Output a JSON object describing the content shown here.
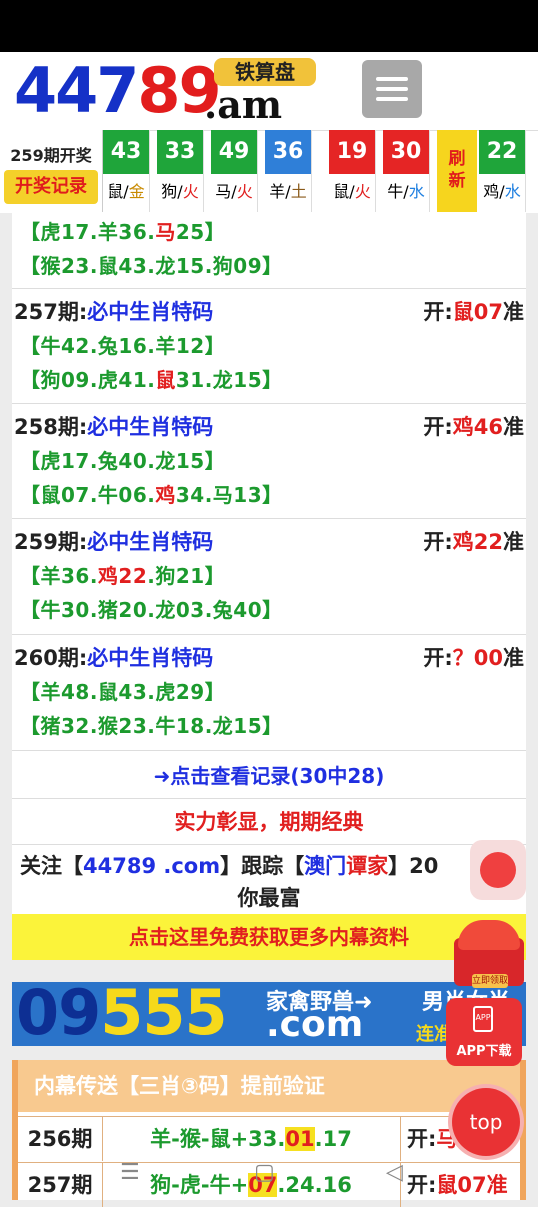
{
  "header": {
    "logo_part1": "447",
    "logo_part2": "89",
    "logo_tag": "铁算盘",
    "logo_suffix": ".am"
  },
  "result_bar": {
    "issue_label": "259期开奖",
    "record_button": "开奖记录",
    "balls": [
      {
        "num": "43",
        "zodiac": "鼠",
        "element": "金",
        "color": "#1fa53a",
        "el_color": "#c88a00"
      },
      {
        "num": "33",
        "zodiac": "狗",
        "element": "火",
        "color": "#1fa53a",
        "el_color": "#e11f1f"
      },
      {
        "num": "49",
        "zodiac": "马",
        "element": "火",
        "color": "#1fa53a",
        "el_color": "#e11f1f"
      },
      {
        "num": "36",
        "zodiac": "羊",
        "element": "土",
        "color": "#2f7fd8",
        "el_color": "#8a5a1a"
      },
      {
        "num": "19",
        "zodiac": "鼠",
        "element": "火",
        "color": "#e52525",
        "el_color": "#e11f1f"
      },
      {
        "num": "30",
        "zodiac": "牛",
        "element": "水",
        "color": "#e52525",
        "el_color": "#1f7fe0"
      },
      {
        "num": "22",
        "zodiac": "鸡",
        "element": "水",
        "color": "#1fa53a",
        "el_color": "#1f7fe0"
      }
    ],
    "refresh_line1": "刷",
    "refresh_line2": "新"
  },
  "entries": [
    {
      "lines": [
        [
          "【虎17.羊36.",
          "马",
          "25】"
        ],
        [
          "【猴23.鼠43.龙15.狗09】",
          "",
          ""
        ]
      ]
    },
    {
      "issue": "257期:",
      "title": "必中生肖特码",
      "open_label": "开:",
      "open_zodiac": "鼠",
      "open_num": "07",
      "open_suffix": "准",
      "lines": [
        [
          "【牛42.兔16.羊12】",
          "",
          ""
        ],
        [
          "【狗09.虎41.",
          "鼠",
          "31.龙15】"
        ]
      ]
    },
    {
      "issue": "258期:",
      "title": "必中生肖特码",
      "open_label": "开:",
      "open_zodiac": "鸡",
      "open_num": "46",
      "open_suffix": "准",
      "lines": [
        [
          "【虎17.兔40.龙15】",
          "",
          ""
        ],
        [
          "【鼠07.牛06.",
          "鸡",
          "34.马13】"
        ]
      ]
    },
    {
      "issue": "259期:",
      "title": "必中生肖特码",
      "open_label": "开:",
      "open_zodiac": "鸡",
      "open_num": "22",
      "open_suffix": "准",
      "lines": [
        [
          "【羊36.",
          "鸡22",
          ".狗21】"
        ],
        [
          "【牛30.猪20.龙03.兔40】",
          "",
          ""
        ]
      ]
    },
    {
      "issue": "260期:",
      "title": "必中生肖特码",
      "open_label": "开:",
      "open_zodiac": "？",
      "open_num": "00",
      "open_suffix": "准",
      "lines": [
        [
          "【羊48.鼠43.虎29】",
          "",
          ""
        ],
        [
          "【猪32.猴23.牛18.龙15】",
          "",
          ""
        ]
      ]
    }
  ],
  "link_text": "➜点击查看记录(30中28)",
  "slogan": "实力彰显，期期经典",
  "follow": {
    "prefix": "关注【",
    "site": "44789 .com",
    "mid": "】跟踪【",
    "name1": "澳门",
    "name2": "谭家",
    "suffix": "】20",
    "line2": "你最富"
  },
  "yellow_banner": "点击这里免费获取更多内幕资料",
  "ad": {
    "big1": "09",
    "big2": "555",
    "com": ".com",
    "text1": "家禽野兽➜",
    "text2": "男肖女肖",
    "text3": "连准"
  },
  "bottom": {
    "header": "内幕传送【三肖③码】提前验证",
    "rows": [
      {
        "issue": "256期",
        "mid_a": "羊-猴-鼠+33.",
        "mid_hl": "01",
        "mid_b": ".17",
        "open_a": "开:",
        "open_b": "马"
      },
      {
        "issue": "257期",
        "mid_a": "狗-虎-牛+",
        "mid_hl": "07",
        "mid_b": ".24.16",
        "open_a": "开:",
        "open_b": "鼠07准"
      }
    ]
  },
  "floating": {
    "envelope_label": "立即领取",
    "app_label": "APP下载",
    "app_icon_text": "APP",
    "top_label": "top"
  },
  "navbar": {
    "menu": "☰",
    "home": "▢",
    "back": "◁"
  }
}
